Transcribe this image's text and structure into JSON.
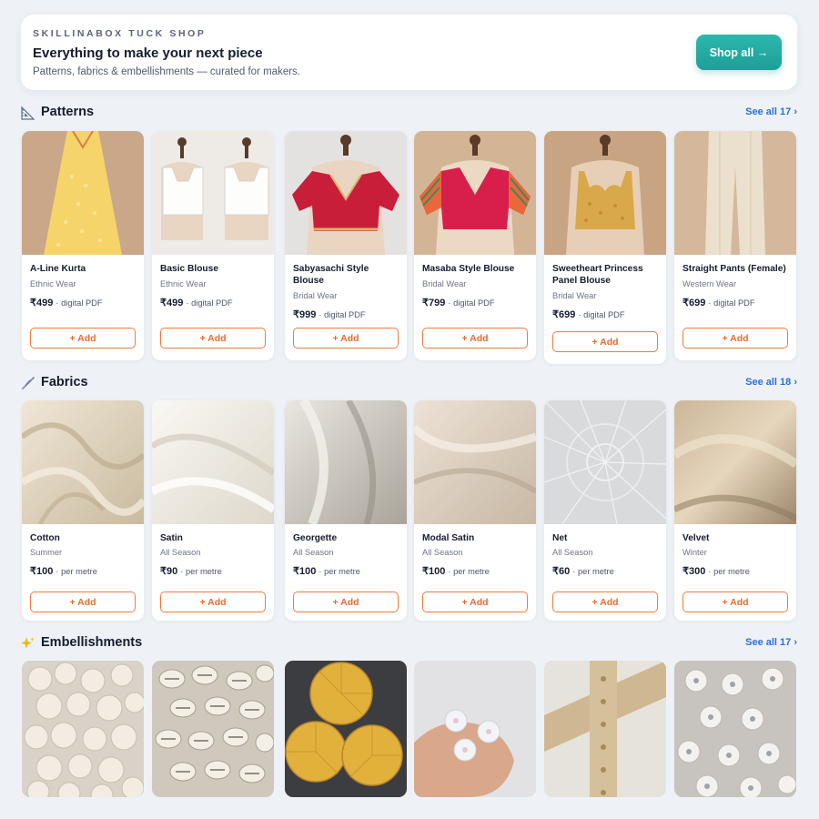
{
  "banner": {
    "eyebrow": "SKILLINABOX TUCK SHOP",
    "title": "Everything to make your next piece",
    "subtitle": "Patterns, fabrics & embellishments — curated for makers.",
    "shop_all": "Shop all →"
  },
  "sections": {
    "patterns": {
      "icon": "📐",
      "icon_name": "triangle-ruler-icon",
      "title": "Patterns",
      "see_all": "See all 17 ›",
      "items": [
        {
          "name": "A-Line Kurta",
          "category": "Ethnic Wear",
          "price": "₹499",
          "unit": "· digital PDF",
          "add": "+ Add"
        },
        {
          "name": "Basic Blouse",
          "category": "Ethnic Wear",
          "price": "₹499",
          "unit": "· digital PDF",
          "add": "+ Add"
        },
        {
          "name": "Sabyasachi Style Blouse",
          "category": "Bridal Wear",
          "price": "₹999",
          "unit": "· digital PDF",
          "add": "+ Add"
        },
        {
          "name": "Masaba Style Blouse",
          "category": "Bridal Wear",
          "price": "₹799",
          "unit": "· digital PDF",
          "add": "+ Add"
        },
        {
          "name": "Sweetheart Princess Panel Blouse",
          "category": "Bridal Wear",
          "price": "₹699",
          "unit": "· digital PDF",
          "add": "+ Add"
        },
        {
          "name": "Straight Pants (Female)",
          "category": "Western Wear",
          "price": "₹699",
          "unit": "· digital PDF",
          "add": "+ Add"
        }
      ]
    },
    "fabrics": {
      "icon": "🪡",
      "icon_name": "sewing-needle-icon",
      "title": "Fabrics",
      "see_all": "See all 18 ›",
      "items": [
        {
          "name": "Cotton",
          "category": "Summer",
          "price": "₹100",
          "unit": "· per metre",
          "add": "+ Add"
        },
        {
          "name": "Satin",
          "category": "All Season",
          "price": "₹90",
          "unit": "· per metre",
          "add": "+ Add"
        },
        {
          "name": "Georgette",
          "category": "All Season",
          "price": "₹100",
          "unit": "· per metre",
          "add": "+ Add"
        },
        {
          "name": "Modal Satin",
          "category": "All Season",
          "price": "₹100",
          "unit": "· per metre",
          "add": "+ Add"
        },
        {
          "name": "Net",
          "category": "All Season",
          "price": "₹60",
          "unit": "· per metre",
          "add": "+ Add"
        },
        {
          "name": "Velvet",
          "category": "Winter",
          "price": "₹300",
          "unit": "· per metre",
          "add": "+ Add"
        }
      ]
    },
    "embellishments": {
      "icon": "✨",
      "icon_name": "sparkles-icon",
      "title": "Embellishments",
      "see_all": "See all 17 ›"
    }
  },
  "colors": {
    "accent": "#1d9f97",
    "add_button": "#ea6a2c",
    "link": "#2a6fd6"
  }
}
